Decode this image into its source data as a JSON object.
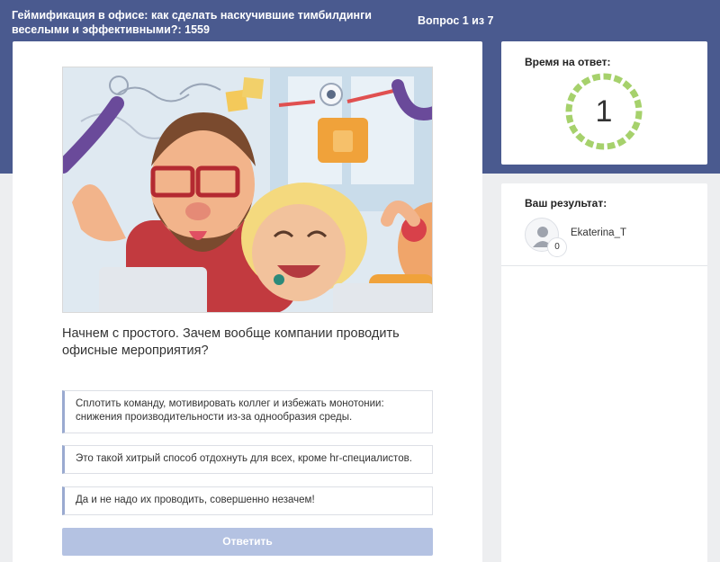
{
  "header": {
    "quiz_title": "Геймификация в офисе: как сделать наскучившие тимбилдинги веселыми и эффективными?: 1559",
    "question_counter": "Вопрос 1 из 7"
  },
  "question": {
    "image_icon": "office-team-illustration",
    "text": "Начнем с простого. Зачем вообще компании проводить офисные мероприятия?",
    "answers": [
      "Сплотить команду, мотивировать коллег и избежать монотонии: снижения производительности из-за однообразия среды.",
      "Это такой хитрый способ отдохнуть для всех, кроме hr-специалистов.",
      "Да и не надо их проводить, совершенно незачем!"
    ],
    "submit_label": "Ответить"
  },
  "timer": {
    "label": "Время на ответ:",
    "value": "1"
  },
  "results": {
    "label": "Ваш результат:",
    "user_name": "Ekaterina_T",
    "score": "0",
    "avatar_icon": "user-icon"
  },
  "colors": {
    "header_bg": "#4a5a8f",
    "timer_ring": "#a6d16c",
    "button_bg": "#b4c2e2",
    "answer_accent": "#9aaad0"
  }
}
